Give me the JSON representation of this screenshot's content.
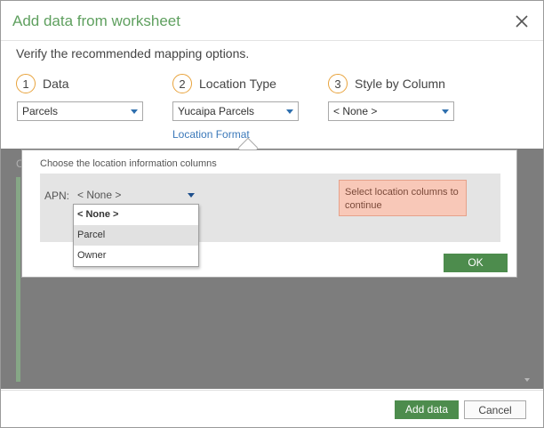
{
  "dialog": {
    "title": "Add data from worksheet",
    "instruction": "Verify the recommended mapping options."
  },
  "steps": [
    {
      "number": "1",
      "label": "Data",
      "value": "Parcels"
    },
    {
      "number": "2",
      "label": "Location Type",
      "value": "Yucaipa Parcels"
    },
    {
      "number": "3",
      "label": "Style by Column",
      "value": "< None >"
    }
  ],
  "location_format_link": "Location Format",
  "background": {
    "partial_label": "C"
  },
  "popup": {
    "title": "Choose the location information columns",
    "apn_label": "APN:",
    "apn_value": "< None >",
    "warning": "Select location columns to continue",
    "ok_label": "OK"
  },
  "dropdown": {
    "options": [
      "< None >",
      "Parcel",
      "Owner"
    ],
    "selected": "< None >",
    "highlighted": "Parcel"
  },
  "footer": {
    "add_label": "Add data",
    "cancel_label": "Cancel"
  },
  "colors": {
    "accent_green": "#5fa05f",
    "button_green": "#4d8c4d",
    "step_circle": "#e8a33c",
    "link_blue": "#3a78b9",
    "warning_bg": "#f8c8b8"
  },
  "icons": {
    "close": "close-icon",
    "dropdown_arrow": "chevron-down-icon"
  }
}
